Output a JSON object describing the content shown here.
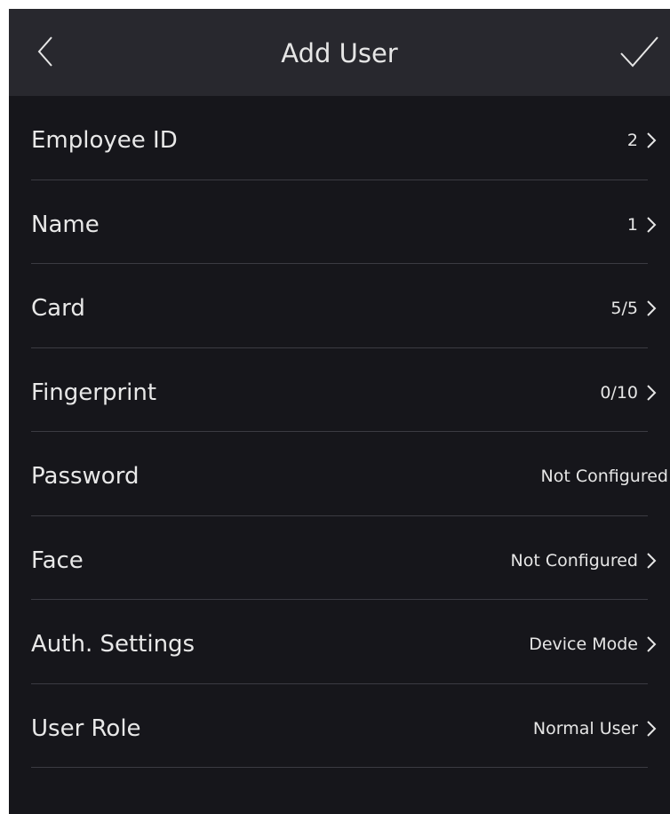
{
  "header": {
    "title": "Add User",
    "back_icon": "chevron-left-icon",
    "confirm_icon": "checkmark-icon"
  },
  "rows": [
    {
      "label": "Employee ID",
      "value": "2",
      "chevron": true
    },
    {
      "label": "Name",
      "value": "1",
      "chevron": true
    },
    {
      "label": "Card",
      "value": "5/5",
      "chevron": true
    },
    {
      "label": "Fingerprint",
      "value": "0/10",
      "chevron": true
    },
    {
      "label": "Password",
      "value": "Not Configured",
      "chevron": false
    },
    {
      "label": "Face",
      "value": "Not Configured",
      "chevron": true
    },
    {
      "label": "Auth. Settings",
      "value": "Device Mode",
      "chevron": true
    },
    {
      "label": "User Role",
      "value": "Normal User",
      "chevron": true
    }
  ],
  "colors": {
    "background": "#16161b",
    "header": "#28282e",
    "text": "#e8e8e8",
    "divider": "#3b3b42"
  }
}
